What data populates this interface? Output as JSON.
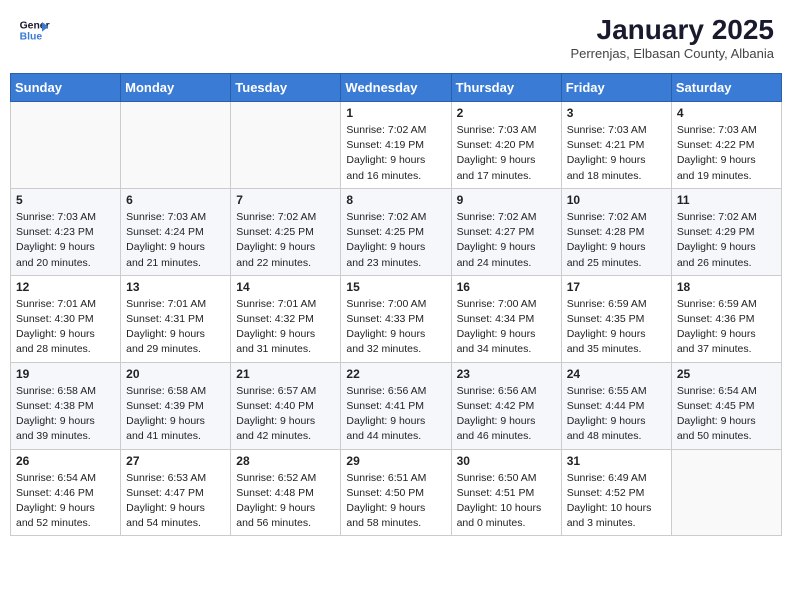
{
  "header": {
    "logo_line1": "General",
    "logo_line2": "Blue",
    "month": "January 2025",
    "location": "Perrenjas, Elbasan County, Albania"
  },
  "weekdays": [
    "Sunday",
    "Monday",
    "Tuesday",
    "Wednesday",
    "Thursday",
    "Friday",
    "Saturday"
  ],
  "weeks": [
    [
      {
        "day": null,
        "sunrise": null,
        "sunset": null,
        "daylight": null
      },
      {
        "day": null,
        "sunrise": null,
        "sunset": null,
        "daylight": null
      },
      {
        "day": null,
        "sunrise": null,
        "sunset": null,
        "daylight": null
      },
      {
        "day": "1",
        "sunrise": "7:02 AM",
        "sunset": "4:19 PM",
        "daylight": "9 hours and 16 minutes."
      },
      {
        "day": "2",
        "sunrise": "7:03 AM",
        "sunset": "4:20 PM",
        "daylight": "9 hours and 17 minutes."
      },
      {
        "day": "3",
        "sunrise": "7:03 AM",
        "sunset": "4:21 PM",
        "daylight": "9 hours and 18 minutes."
      },
      {
        "day": "4",
        "sunrise": "7:03 AM",
        "sunset": "4:22 PM",
        "daylight": "9 hours and 19 minutes."
      }
    ],
    [
      {
        "day": "5",
        "sunrise": "7:03 AM",
        "sunset": "4:23 PM",
        "daylight": "9 hours and 20 minutes."
      },
      {
        "day": "6",
        "sunrise": "7:03 AM",
        "sunset": "4:24 PM",
        "daylight": "9 hours and 21 minutes."
      },
      {
        "day": "7",
        "sunrise": "7:02 AM",
        "sunset": "4:25 PM",
        "daylight": "9 hours and 22 minutes."
      },
      {
        "day": "8",
        "sunrise": "7:02 AM",
        "sunset": "4:25 PM",
        "daylight": "9 hours and 23 minutes."
      },
      {
        "day": "9",
        "sunrise": "7:02 AM",
        "sunset": "4:27 PM",
        "daylight": "9 hours and 24 minutes."
      },
      {
        "day": "10",
        "sunrise": "7:02 AM",
        "sunset": "4:28 PM",
        "daylight": "9 hours and 25 minutes."
      },
      {
        "day": "11",
        "sunrise": "7:02 AM",
        "sunset": "4:29 PM",
        "daylight": "9 hours and 26 minutes."
      }
    ],
    [
      {
        "day": "12",
        "sunrise": "7:01 AM",
        "sunset": "4:30 PM",
        "daylight": "9 hours and 28 minutes."
      },
      {
        "day": "13",
        "sunrise": "7:01 AM",
        "sunset": "4:31 PM",
        "daylight": "9 hours and 29 minutes."
      },
      {
        "day": "14",
        "sunrise": "7:01 AM",
        "sunset": "4:32 PM",
        "daylight": "9 hours and 31 minutes."
      },
      {
        "day": "15",
        "sunrise": "7:00 AM",
        "sunset": "4:33 PM",
        "daylight": "9 hours and 32 minutes."
      },
      {
        "day": "16",
        "sunrise": "7:00 AM",
        "sunset": "4:34 PM",
        "daylight": "9 hours and 34 minutes."
      },
      {
        "day": "17",
        "sunrise": "6:59 AM",
        "sunset": "4:35 PM",
        "daylight": "9 hours and 35 minutes."
      },
      {
        "day": "18",
        "sunrise": "6:59 AM",
        "sunset": "4:36 PM",
        "daylight": "9 hours and 37 minutes."
      }
    ],
    [
      {
        "day": "19",
        "sunrise": "6:58 AM",
        "sunset": "4:38 PM",
        "daylight": "9 hours and 39 minutes."
      },
      {
        "day": "20",
        "sunrise": "6:58 AM",
        "sunset": "4:39 PM",
        "daylight": "9 hours and 41 minutes."
      },
      {
        "day": "21",
        "sunrise": "6:57 AM",
        "sunset": "4:40 PM",
        "daylight": "9 hours and 42 minutes."
      },
      {
        "day": "22",
        "sunrise": "6:56 AM",
        "sunset": "4:41 PM",
        "daylight": "9 hours and 44 minutes."
      },
      {
        "day": "23",
        "sunrise": "6:56 AM",
        "sunset": "4:42 PM",
        "daylight": "9 hours and 46 minutes."
      },
      {
        "day": "24",
        "sunrise": "6:55 AM",
        "sunset": "4:44 PM",
        "daylight": "9 hours and 48 minutes."
      },
      {
        "day": "25",
        "sunrise": "6:54 AM",
        "sunset": "4:45 PM",
        "daylight": "9 hours and 50 minutes."
      }
    ],
    [
      {
        "day": "26",
        "sunrise": "6:54 AM",
        "sunset": "4:46 PM",
        "daylight": "9 hours and 52 minutes."
      },
      {
        "day": "27",
        "sunrise": "6:53 AM",
        "sunset": "4:47 PM",
        "daylight": "9 hours and 54 minutes."
      },
      {
        "day": "28",
        "sunrise": "6:52 AM",
        "sunset": "4:48 PM",
        "daylight": "9 hours and 56 minutes."
      },
      {
        "day": "29",
        "sunrise": "6:51 AM",
        "sunset": "4:50 PM",
        "daylight": "9 hours and 58 minutes."
      },
      {
        "day": "30",
        "sunrise": "6:50 AM",
        "sunset": "4:51 PM",
        "daylight": "10 hours and 0 minutes."
      },
      {
        "day": "31",
        "sunrise": "6:49 AM",
        "sunset": "4:52 PM",
        "daylight": "10 hours and 3 minutes."
      },
      {
        "day": null,
        "sunrise": null,
        "sunset": null,
        "daylight": null
      }
    ]
  ]
}
